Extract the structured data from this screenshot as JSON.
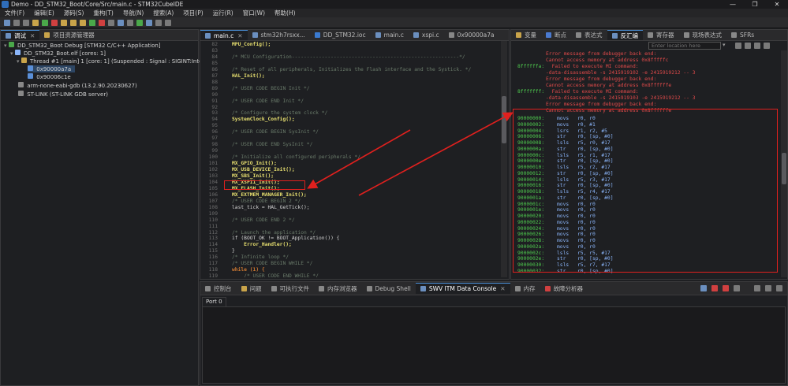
{
  "window": {
    "title": "Demo - DD_STM32_Boot/Core/Src/main.c - STM32CubeIDE",
    "controls": [
      "—",
      "❐",
      "✕"
    ]
  },
  "menu": [
    "文件(F)",
    "编辑(E)",
    "源码(S)",
    "重构(T)",
    "导航(N)",
    "搜索(A)",
    "项目(P)",
    "运行(R)",
    "窗口(W)",
    "帮助(H)"
  ],
  "left_tabs": [
    {
      "label": "调试",
      "active": true
    },
    {
      "label": "项目资源管理器",
      "active": false
    }
  ],
  "debug_tree": [
    {
      "text": "DD_STM32_Boot Debug [STM32 C/C++ Application]",
      "indent": 0
    },
    {
      "text": "DD_STM32_Boot.elf [cores: 1]",
      "indent": 1
    },
    {
      "text": "Thread #1 [main] 1 [core: 1] (Suspended : Signal : SIGINT:Interrupt)",
      "indent": 2
    },
    {
      "text": "0x90000a7a",
      "indent": 3,
      "selected": true
    },
    {
      "text": "0x90006c1e",
      "indent": 3
    },
    {
      "text": "arm-none-eabi-gdb (13.2.90.20230627)",
      "indent": 1
    },
    {
      "text": "ST-LINK (ST-LINK GDB server)",
      "indent": 1
    }
  ],
  "editor_tabs": [
    {
      "label": "main.c",
      "active": true,
      "close": "✕"
    },
    {
      "label": "stm32h7rsxx...",
      "active": false
    },
    {
      "label": "DD_STM32.ioc",
      "active": false
    },
    {
      "label": "main.c",
      "active": false
    },
    {
      "label": "xspi.c",
      "active": false
    },
    {
      "label": "0x90000a7a",
      "active": false
    }
  ],
  "code_lines": [
    {
      "n": "82",
      "t": "MPU_Config();",
      "k": "func"
    },
    {
      "n": "83",
      "t": "",
      "k": "plain"
    },
    {
      "n": "84",
      "t": "/* MCU Configuration--------------------------------------------------------*/",
      "k": "comment"
    },
    {
      "n": "85",
      "t": "",
      "k": "plain"
    },
    {
      "n": "86",
      "t": "/* Reset of all peripherals, Initializes the Flash interface and the Systick. */",
      "k": "comment"
    },
    {
      "n": "87",
      "t": "HAL_Init();",
      "k": "func"
    },
    {
      "n": "88",
      "t": "",
      "k": "plain"
    },
    {
      "n": "89",
      "t": "/* USER CODE BEGIN Init */",
      "k": "comment"
    },
    {
      "n": "90",
      "t": "",
      "k": "plain"
    },
    {
      "n": "91",
      "t": "/* USER CODE END Init */",
      "k": "comment"
    },
    {
      "n": "92",
      "t": "",
      "k": "plain"
    },
    {
      "n": "93",
      "t": "/* Configure the system clock */",
      "k": "comment"
    },
    {
      "n": "94",
      "t": "SystemClock_Config();",
      "k": "func"
    },
    {
      "n": "95",
      "t": "",
      "k": "plain"
    },
    {
      "n": "96",
      "t": "/* USER CODE BEGIN SysInit */",
      "k": "comment"
    },
    {
      "n": "97",
      "t": "",
      "k": "plain"
    },
    {
      "n": "98",
      "t": "/* USER CODE END SysInit */",
      "k": "comment"
    },
    {
      "n": "99",
      "t": "",
      "k": "plain"
    },
    {
      "n": "100",
      "t": "/* Initialize all configured peripherals */",
      "k": "comment"
    },
    {
      "n": "101",
      "t": "MX_GPIO_Init();",
      "k": "func"
    },
    {
      "n": "102",
      "t": "MX_USB_DEVICE_Init();",
      "k": "func"
    },
    {
      "n": "103",
      "t": "MX_SBS_Init();",
      "k": "func"
    },
    {
      "n": "104",
      "t": "MX_XSPI1_Init();",
      "k": "func"
    },
    {
      "n": "105",
      "t": "MX_FLASH_Init();",
      "k": "func"
    },
    {
      "n": "106",
      "t": "MX_EXTMEM_MANAGER_Init();",
      "k": "func"
    },
    {
      "n": "107",
      "t": "/* USER CODE BEGIN 2 */",
      "k": "comment"
    },
    {
      "n": "108",
      "t": "last_tick = HAL_GetTick();",
      "k": "plain"
    },
    {
      "n": "109",
      "t": "",
      "k": "plain"
    },
    {
      "n": "110",
      "t": "/* USER CODE END 2 */",
      "k": "comment"
    },
    {
      "n": "111",
      "t": "",
      "k": "plain"
    },
    {
      "n": "112",
      "t": "/* Launch the application */",
      "k": "comment"
    },
    {
      "n": "113",
      "t": "if (BOOT_OK != BOOT_Application()) {",
      "k": "plain"
    },
    {
      "n": "114",
      "t": "    Error_Handler();",
      "k": "func"
    },
    {
      "n": "115",
      "t": "}",
      "k": "plain"
    },
    {
      "n": "116",
      "t": "/* Infinite loop */",
      "k": "comment"
    },
    {
      "n": "117",
      "t": "/* USER CODE BEGIN WHILE */",
      "k": "comment"
    },
    {
      "n": "118",
      "t": "while (1) {",
      "k": "kw"
    },
    {
      "n": "119",
      "t": "    /* USER CODE END WHILE */",
      "k": "comment"
    }
  ],
  "right_tabs": [
    "变量",
    "断点",
    "表达式",
    "反汇编",
    "寄存器",
    "现场表达式",
    "SFRs"
  ],
  "right_active": "反汇编",
  "location_placeholder": "Enter location here",
  "disasm_errors": [
    {
      "addr": "",
      "text": "Error message from debugger back end:"
    },
    {
      "addr": "",
      "text": "Cannot access memory at address 0x8fffffc"
    },
    {
      "addr": "8ffffffa:",
      "text": "  Failed to execute MI command:"
    },
    {
      "addr": "",
      "text": "-data-disassemble -s 2415919102 -e 2415919212 -- 3"
    },
    {
      "addr": "",
      "text": "Error message from debugger back end:"
    },
    {
      "addr": "",
      "text": "Cannot access memory at address 0x8ffffffe"
    },
    {
      "addr": "8fffffff:",
      "text": "  Failed to execute MI command:"
    },
    {
      "addr": "",
      "text": "-data-disassemble -s 2415919103 -e 2415919212 -- 3"
    },
    {
      "addr": "",
      "text": "Error message from debugger back end:"
    },
    {
      "addr": "",
      "text": "Cannot access memory at address 0x8ffffffe"
    }
  ],
  "disasm_rows": [
    [
      "90000000:",
      "movs",
      "r0, r0"
    ],
    [
      "90000002:",
      "movs",
      "r0, #1"
    ],
    [
      "90000004:",
      "lsrs",
      "r1, r2, #5"
    ],
    [
      "90000006:",
      "str",
      "r0, [sp, #0]"
    ],
    [
      "90000008:",
      "lsls",
      "r5, r0, #17"
    ],
    [
      "9000000a:",
      "str",
      "r0, [sp, #0]"
    ],
    [
      "9000000c:",
      "lsls",
      "r5, r1, #17"
    ],
    [
      "9000000e:",
      "str",
      "r0, [sp, #0]"
    ],
    [
      "90000010:",
      "lsls",
      "r5, r2, #17"
    ],
    [
      "90000012:",
      "str",
      "r0, [sp, #0]"
    ],
    [
      "90000014:",
      "lsls",
      "r5, r3, #17"
    ],
    [
      "90000016:",
      "str",
      "r0, [sp, #0]"
    ],
    [
      "90000018:",
      "lsls",
      "r5, r4, #17"
    ],
    [
      "9000001a:",
      "str",
      "r0, [sp, #0]"
    ],
    [
      "9000001c:",
      "movs",
      "r0, r0"
    ],
    [
      "9000001e:",
      "movs",
      "r0, r0"
    ],
    [
      "90000020:",
      "movs",
      "r0, r0"
    ],
    [
      "90000022:",
      "movs",
      "r0, r0"
    ],
    [
      "90000024:",
      "movs",
      "r0, r0"
    ],
    [
      "90000026:",
      "movs",
      "r0, r0"
    ],
    [
      "90000028:",
      "movs",
      "r0, r0"
    ],
    [
      "9000002a:",
      "movs",
      "r0, r0"
    ],
    [
      "9000002c:",
      "lsls",
      "r5, r5, #17"
    ],
    [
      "9000002e:",
      "str",
      "r0, [sp, #0]"
    ],
    [
      "90000030:",
      "lsls",
      "r5, r7, #17"
    ],
    [
      "90000032:",
      "str",
      "r0, [sp, #0]"
    ]
  ],
  "bottom_tabs": [
    "控制台",
    "问题",
    "可执行文件",
    "内存浏览器",
    "Debug Shell",
    "SWV ITM Data Console",
    "内存",
    "故障分析器"
  ],
  "bottom_active": "SWV ITM Data Console",
  "port_tab": "Port 0",
  "colors": {
    "annotation_red": "#e0201e",
    "accent": "#4a8fd8"
  }
}
